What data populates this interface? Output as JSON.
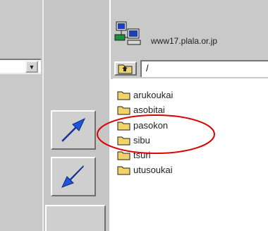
{
  "remote": {
    "host": "www17.plala.or.jp",
    "path": "/",
    "files": [
      "arukoukai",
      "asobitai",
      "pasokon",
      "sibu",
      "tsuri",
      "utusoukai"
    ],
    "highlighted_file": "pasokon"
  },
  "colors": {
    "panel_gray": "#c9c9c9",
    "arrow_blue": "#1e56d8",
    "folder_yellow": "#f2d36a",
    "highlight_red": "#dd0000"
  }
}
